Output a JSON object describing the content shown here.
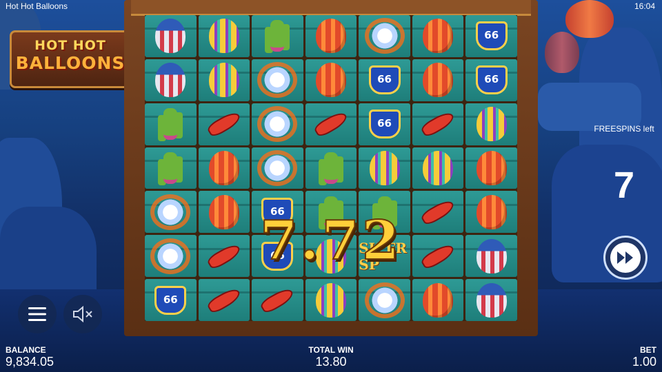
{
  "app": {
    "title": "Hot Hot Balloons",
    "clock": "16:04"
  },
  "logo": {
    "line1": "HOT HOT",
    "line2": "BALLOONS"
  },
  "grid": [
    [
      "balloon-usa",
      "balloon-stripe",
      "cactus",
      "balloon-red",
      "diamond",
      "balloon-red",
      "route-66"
    ],
    [
      "balloon-usa",
      "balloon-stripe",
      "diamond",
      "balloon-red",
      "route-66",
      "balloon-red",
      "route-66"
    ],
    [
      "cactus",
      "chili",
      "diamond",
      "chili",
      "route-66",
      "chili",
      "balloon-stripe"
    ],
    [
      "cactus",
      "balloon-red",
      "diamond",
      "cactus",
      "balloon-stripe",
      "balloon-stripe",
      "balloon-red"
    ],
    [
      "diamond",
      "balloon-red",
      "route-66",
      "cactus",
      "cactus",
      "chili",
      "balloon-red"
    ],
    [
      "diamond",
      "chili",
      "route-66",
      "balloon-stripe",
      "wild",
      "chili",
      "balloon-usa"
    ],
    [
      "route-66",
      "chili",
      "chili",
      "balloon-stripe",
      "diamond",
      "balloon-red",
      "balloon-usa"
    ]
  ],
  "symbols": {
    "route_text": "66",
    "wild_text": "SU FR SP"
  },
  "win_overlay": {
    "chars": [
      "7",
      ".",
      "7",
      "2"
    ]
  },
  "freespins": {
    "label": "FREESPINS left",
    "count": "7"
  },
  "hud": {
    "balance_label": "BALANCE",
    "balance_value": "9,834.05",
    "win_label": "TOTAL WIN",
    "win_value": "13.80",
    "bet_label": "BET",
    "bet_value": "1.00"
  },
  "colors": {
    "accent": "#ffcf3a",
    "reel_bg": "#2e9a95",
    "frame": "#7a4522"
  }
}
